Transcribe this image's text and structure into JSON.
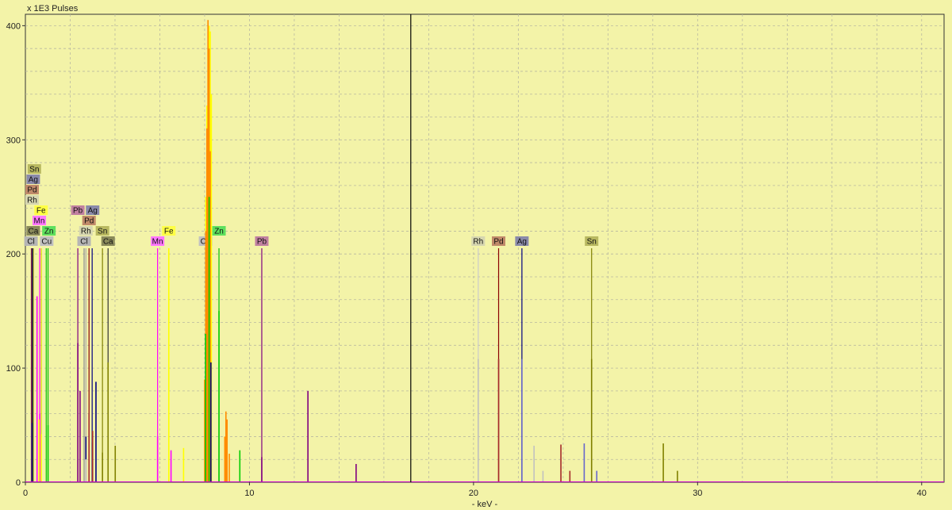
{
  "chart_data": {
    "type": "line",
    "title": "",
    "ylabel": "x 1E3 Pulses",
    "xlabel": "- keV -",
    "xlim": [
      0,
      41
    ],
    "ylim": [
      0,
      410
    ],
    "x_ticks": [
      0,
      10,
      20,
      30,
      40
    ],
    "y_ticks": [
      0,
      100,
      200,
      300,
      400
    ],
    "grid": true,
    "cursor_kev": 17.2,
    "series": [
      {
        "color": "#ff00ff",
        "x": [
          0.52,
          0.64,
          5.9,
          6.5
        ],
        "values": [
          163,
          60,
          40,
          28
        ]
      },
      {
        "color": "#ffff00",
        "x": [
          0.61,
          0.7,
          6.4,
          7.06,
          8.05,
          8.1,
          8.15,
          8.2,
          8.25,
          8.3
        ],
        "values": [
          55,
          42,
          205,
          30,
          250,
          330,
          380,
          400,
          395,
          340
        ]
      },
      {
        "color": "#ff8c00",
        "x": [
          8.0,
          8.05,
          8.1,
          8.15,
          8.2,
          8.25,
          8.9,
          8.95,
          9.0,
          9.1
        ],
        "values": [
          90,
          220,
          310,
          405,
          380,
          290,
          40,
          62,
          55,
          25
        ]
      },
      {
        "color": "#00cc00",
        "x": [
          1.01,
          8.04,
          8.2,
          8.64,
          9.57
        ],
        "values": [
          50,
          130,
          250,
          150,
          28
        ]
      },
      {
        "color": "#000080",
        "x": [
          0.3,
          2.7,
          2.99,
          3.15,
          8.28
        ],
        "values": [
          52,
          40,
          35,
          88,
          105
        ]
      },
      {
        "color": "#800080",
        "x": [
          2.34,
          2.44,
          10.55,
          12.61,
          14.76
        ],
        "values": [
          122,
          80,
          22,
          80,
          16
        ]
      },
      {
        "color": "#808000",
        "x": [
          3.44,
          3.69,
          4.01,
          25.27,
          28.47,
          29.1
        ],
        "values": [
          26,
          105,
          32,
          108,
          34,
          10
        ]
      },
      {
        "color": "#a52a2a",
        "x": [
          2.84,
          3.0,
          21.12,
          23.9,
          24.3
        ],
        "values": [
          60,
          45,
          108,
          33,
          10
        ]
      },
      {
        "color": "#c0c0c0",
        "x": [
          2.7,
          20.21,
          22.7,
          23.1
        ],
        "values": [
          20,
          108,
          32,
          10
        ]
      },
      {
        "color": "#6666cc",
        "x": [
          22.16,
          24.94,
          25.5
        ],
        "values": [
          108,
          34,
          10
        ]
      }
    ],
    "element_markers": [
      {
        "label": "Cl",
        "kev": 2.62,
        "tag_kev": 0.25,
        "level": 0,
        "bg": "#b5b5b5",
        "line": "#999999"
      },
      {
        "label": "Cu",
        "kev": 0.93,
        "tag_kev": 0.95,
        "level": 0,
        "bg": "#c0c0c0",
        "line": "#00c000"
      },
      {
        "label": "Ca",
        "kev": 0.34,
        "tag_kev": 0.35,
        "level": 1,
        "bg": "#8a8a5a",
        "line": "#333333"
      },
      {
        "label": "Zn",
        "kev": 1.01,
        "tag_kev": 1.05,
        "level": 1,
        "bg": "#5ee05e",
        "line": "#00c000"
      },
      {
        "label": "Mn",
        "kev": 0.64,
        "tag_kev": 0.62,
        "level": 2,
        "bg": "#ff77ff",
        "line": "#ff00ff"
      },
      {
        "label": "Fe",
        "kev": 0.71,
        "tag_kev": 0.7,
        "level": 3,
        "bg": "#ffff44",
        "line": "#dddd00"
      },
      {
        "label": "Rh",
        "kev": 0.26,
        "tag_kev": 0.3,
        "level": 4,
        "bg": "#d6d6b0",
        "line": "#aaaaaa"
      },
      {
        "label": "Pd",
        "kev": 0.28,
        "tag_kev": 0.3,
        "level": 5,
        "bg": "#c08a6a",
        "line": "#8b0000"
      },
      {
        "label": "Ag",
        "kev": 0.31,
        "tag_kev": 0.35,
        "level": 6,
        "bg": "#8a8aaa",
        "line": "#000080"
      },
      {
        "label": "Sn",
        "kev": 0.35,
        "tag_kev": 0.4,
        "level": 7,
        "bg": "#b8b860",
        "line": "#808000"
      },
      {
        "label": "Cl",
        "kev": 2.62,
        "tag_kev": 2.62,
        "level": 0,
        "bg": "#b5b5b5",
        "line": "#999999"
      },
      {
        "label": "Rh",
        "kev": 2.7,
        "tag_kev": 2.7,
        "level": 1,
        "bg": "#d6d6b0",
        "line": "#aaaaaa"
      },
      {
        "label": "Sn",
        "kev": 3.44,
        "tag_kev": 3.44,
        "level": 1,
        "bg": "#b8b860",
        "line": "#808000"
      },
      {
        "label": "Ca",
        "kev": 3.69,
        "tag_kev": 3.69,
        "level": 0,
        "bg": "#8a8a5a",
        "line": "#333333"
      },
      {
        "label": "Pd",
        "kev": 2.84,
        "tag_kev": 2.84,
        "level": 2,
        "bg": "#c08a6a",
        "line": "#8b0000"
      },
      {
        "label": "Pb",
        "kev": 2.34,
        "tag_kev": 2.34,
        "level": 3,
        "bg": "#c080a0",
        "line": "#800080"
      },
      {
        "label": "Ag",
        "kev": 2.98,
        "tag_kev": 3.0,
        "level": 3,
        "bg": "#8a8aaa",
        "line": "#000080"
      },
      {
        "label": "Mn",
        "kev": 5.9,
        "tag_kev": 5.9,
        "level": 0,
        "bg": "#ff77ff",
        "line": "#ff00ff"
      },
      {
        "label": "Fe",
        "kev": 6.4,
        "tag_kev": 6.4,
        "level": 1,
        "bg": "#ffff44",
        "line": "#dddd00"
      },
      {
        "label": "Cu",
        "kev": 8.04,
        "tag_kev": 8.04,
        "level": 0,
        "bg": "#c0c0c0",
        "line": "#00c000"
      },
      {
        "label": "Zn",
        "kev": 8.64,
        "tag_kev": 8.64,
        "level": 1,
        "bg": "#5ee05e",
        "line": "#00c000"
      },
      {
        "label": "Pb",
        "kev": 10.55,
        "tag_kev": 10.55,
        "level": 0,
        "bg": "#c080a0",
        "line": "#800080"
      },
      {
        "label": "Rh",
        "kev": 20.21,
        "tag_kev": 20.21,
        "level": 0,
        "bg": "#d6d6b0",
        "line": "#cccccc"
      },
      {
        "label": "Pd",
        "kev": 21.12,
        "tag_kev": 21.12,
        "level": 0,
        "bg": "#c08a6a",
        "line": "#8b0000"
      },
      {
        "label": "Ag",
        "kev": 22.16,
        "tag_kev": 22.16,
        "level": 0,
        "bg": "#8a8aaa",
        "line": "#000080"
      },
      {
        "label": "Sn",
        "kev": 25.27,
        "tag_kev": 25.27,
        "level": 0,
        "bg": "#b8b860",
        "line": "#808000"
      }
    ]
  }
}
